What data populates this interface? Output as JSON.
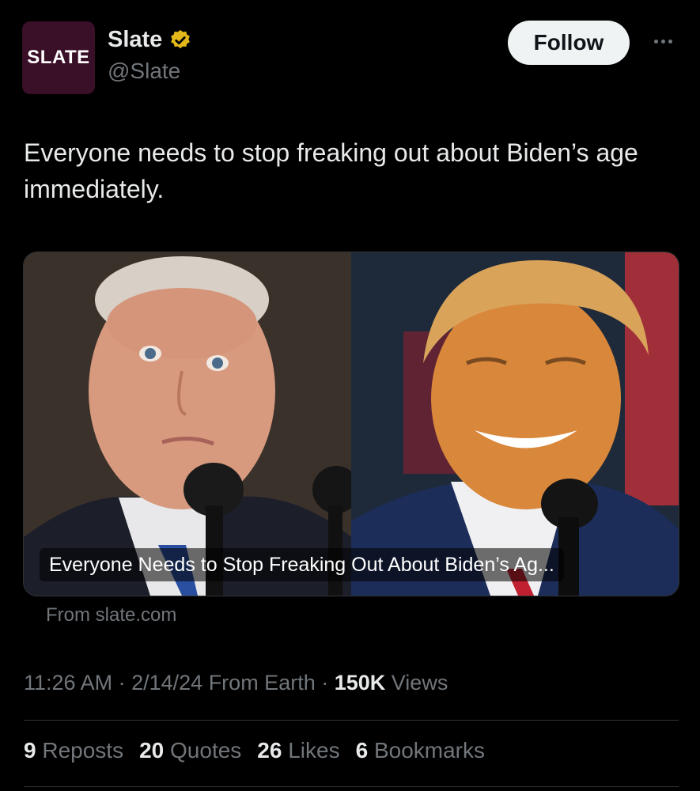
{
  "account": {
    "avatar_text": "SLATE",
    "display_name": "Slate",
    "handle": "@Slate",
    "verified": true,
    "follow_label": "Follow"
  },
  "tweet": {
    "text": "Everyone needs to stop freaking out about Biden’s age immediately."
  },
  "card": {
    "title": "Everyone Needs to Stop Freaking Out About Biden’s Ag...",
    "source": "From slate.com"
  },
  "meta": {
    "time": "11:26 AM",
    "date": "2/14/24",
    "client": "From Earth",
    "views_count": "150K",
    "views_label": "Views"
  },
  "stats": {
    "reposts_count": "9",
    "reposts_label": "Reposts",
    "quotes_count": "20",
    "quotes_label": "Quotes",
    "likes_count": "26",
    "likes_label": "Likes",
    "bookmarks_count": "6",
    "bookmarks_label": "Bookmarks"
  },
  "colors": {
    "background": "#000000",
    "text_primary": "#e7e9ea",
    "text_secondary": "#71767b",
    "verified_badge": "#e2b719",
    "avatar_bg": "#3a0f28"
  }
}
